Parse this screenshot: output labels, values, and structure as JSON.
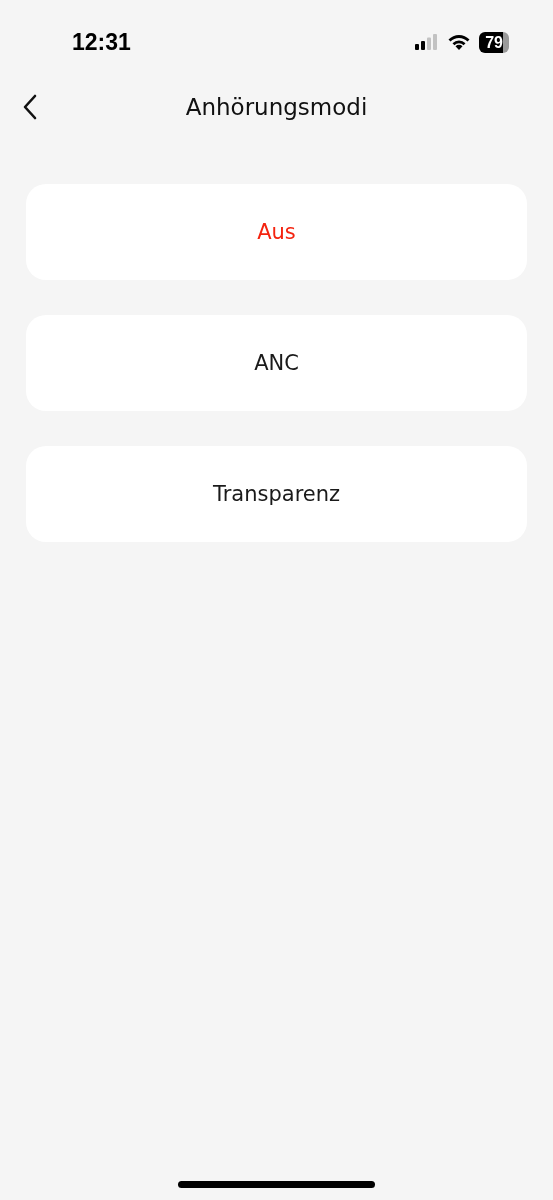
{
  "status_bar": {
    "time": "12:31",
    "battery": "79"
  },
  "header": {
    "title": "Anhörungsmodi"
  },
  "modes": [
    {
      "label": "Aus",
      "selected": true
    },
    {
      "label": "ANC",
      "selected": false
    },
    {
      "label": "Transparenz",
      "selected": false
    }
  ]
}
